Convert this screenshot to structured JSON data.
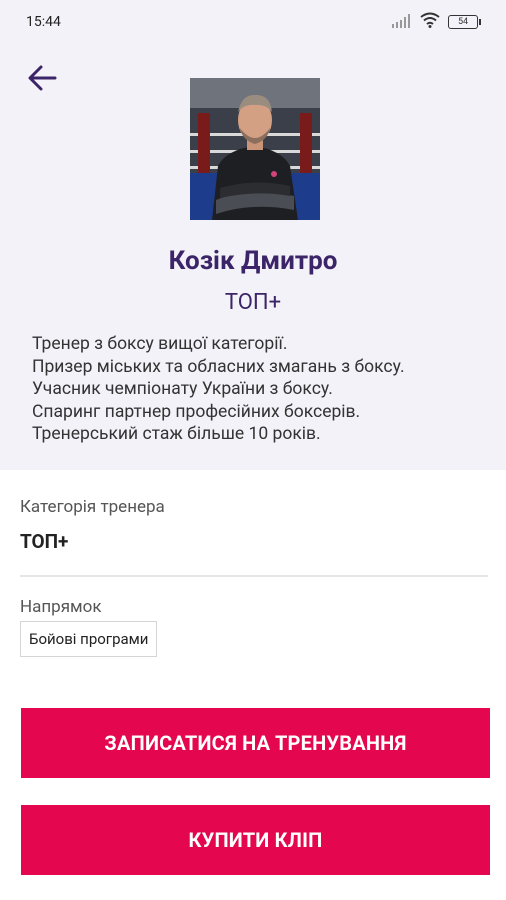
{
  "status_bar": {
    "time": "15:44",
    "battery": "54"
  },
  "trainer": {
    "name": "Козік Дмитро",
    "level": "ТОП+",
    "bio": [
      "Тренер з боксу вищої категорії.",
      "Призер міських та обласних змагань з боксу.",
      "Учасник чемпіонату України з боксу.",
      "Спаринг партнер професійних боксерів.",
      "Тренерський стаж більше 10 років."
    ]
  },
  "details": {
    "category_label": "Категорія тренера",
    "category_value": "ТОП+",
    "direction_label": "Напрямок",
    "direction_value": "Бойові програми"
  },
  "actions": {
    "book_label": "ЗАПИСАТИСЯ НА ТРЕНУВАННЯ",
    "buy_label": "КУПИТИ КЛІП"
  },
  "colors": {
    "accent": "#e4064f",
    "title": "#3b2467",
    "header_bg": "#f3f2f8"
  }
}
